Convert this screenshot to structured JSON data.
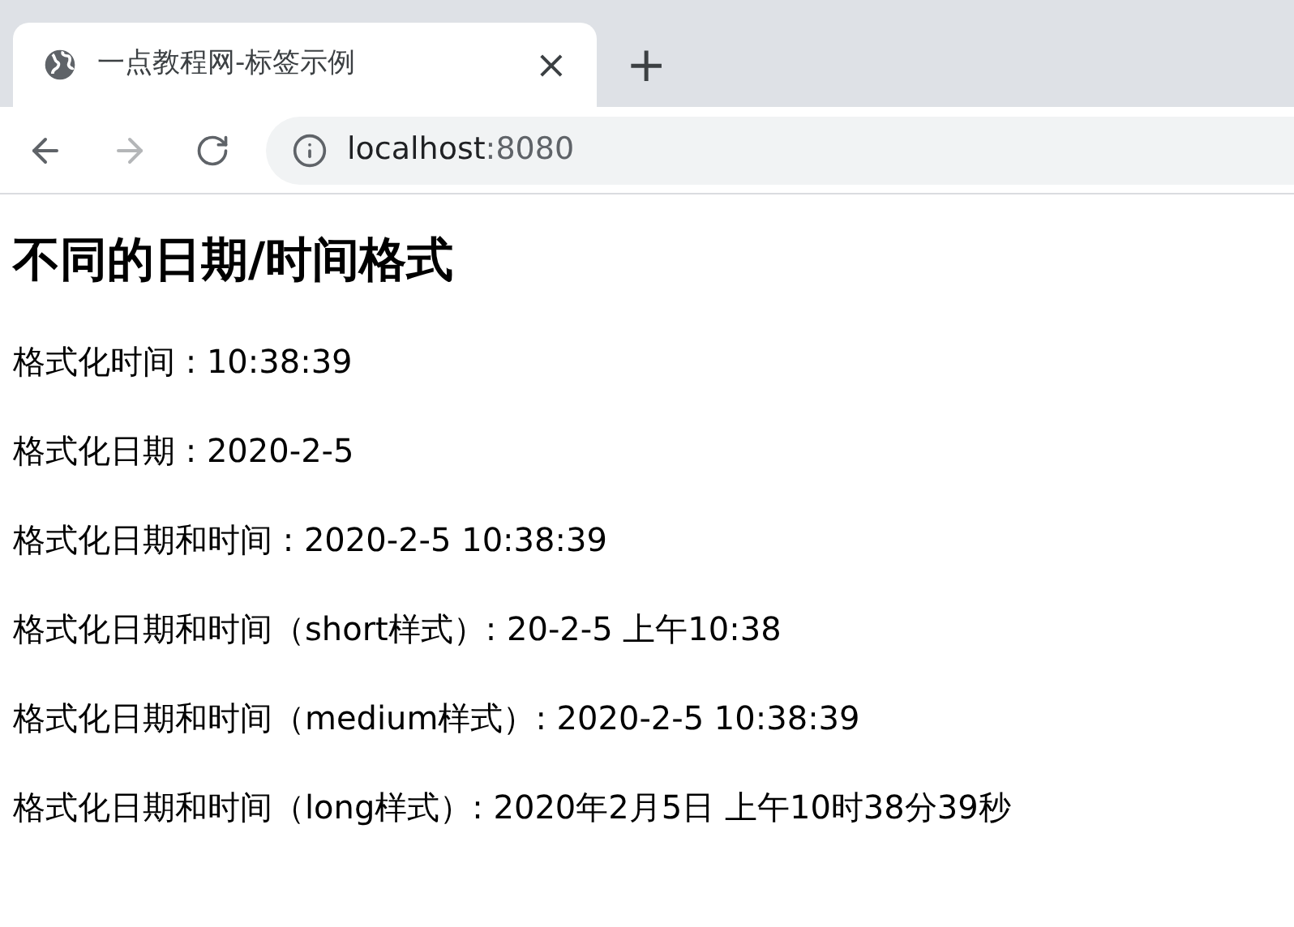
{
  "tab": {
    "title": "一点教程网-标签示例",
    "close": "×",
    "selected": true
  },
  "new_tab": "+",
  "nav": {
    "back_disabled": false,
    "forward_disabled": true
  },
  "address": {
    "host": "localhost",
    "port": ":8080"
  },
  "heading": "不同的日期/时间格式",
  "lines": [
    "格式化时间 : 10:38:39",
    "格式化日期 : 2020-2-5",
    "格式化日期和时间 : 2020-2-5 10:38:39",
    "格式化日期和时间（short样式）: 20-2-5 上午10:38",
    "格式化日期和时间（medium样式）: 2020-2-5 10:38:39",
    "格式化日期和时间（long样式）: 2020年2月5日 上午10时38分39秒"
  ]
}
